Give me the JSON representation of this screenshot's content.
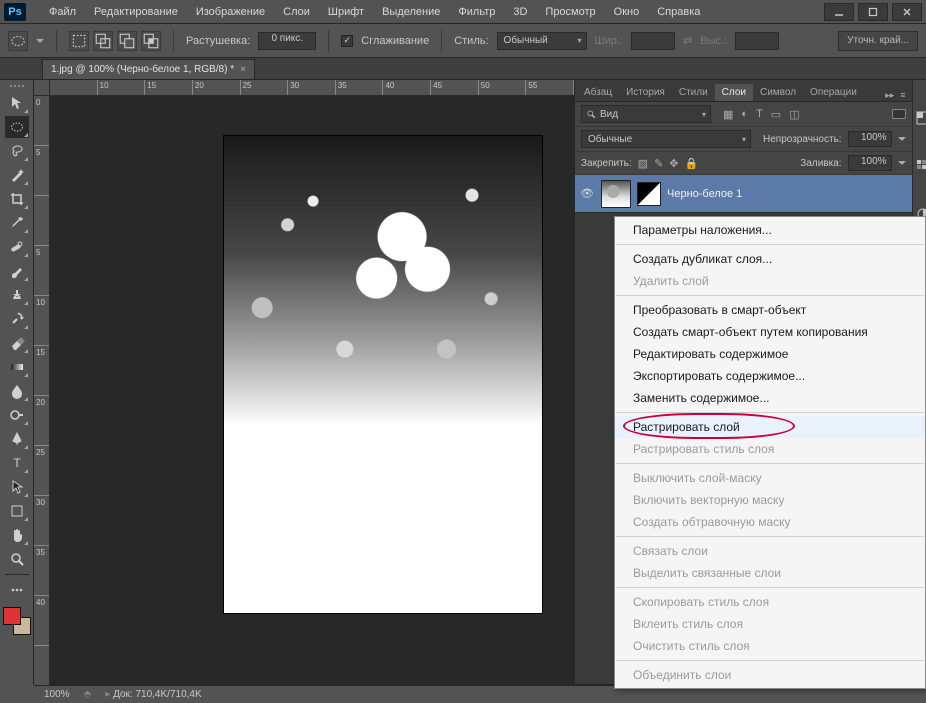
{
  "app": {
    "logo": "Ps"
  },
  "menus": [
    "Файл",
    "Редактирование",
    "Изображение",
    "Слои",
    "Шрифт",
    "Выделение",
    "Фильтр",
    "3D",
    "Просмотр",
    "Окно",
    "Справка"
  ],
  "options": {
    "feather_label": "Растушевка:",
    "feather_value": "0 пикс.",
    "antialias_label": "Сглаживание",
    "style_label": "Стиль:",
    "style_value": "Обычный",
    "width_label": "Шир.:",
    "height_label": "Выс.:",
    "refine_edge": "Уточн. край..."
  },
  "document_tab": {
    "title": "1.jpg @ 100% (Черно-белое 1, RGB/8) *"
  },
  "ruler_h": [
    "",
    "10",
    "15",
    "20",
    "25",
    "30",
    "35",
    "40",
    "45",
    "50",
    "55"
  ],
  "ruler_v": [
    "0",
    "5",
    "",
    "5",
    "10",
    "15",
    "20",
    "25",
    "30",
    "35",
    "40"
  ],
  "panels": {
    "tabs": [
      "Абзац",
      "История",
      "Стили",
      "Слои",
      "Символ",
      "Операции"
    ],
    "tab_icons": "▸▸",
    "menu_icon": "≡"
  },
  "layers": {
    "filter_type": "Вид",
    "blend_mode": "Обычные",
    "opacity_label": "Непрозрачность:",
    "opacity_value": "100%",
    "lock_label": "Закрепить:",
    "fill_label": "Заливка:",
    "fill_value": "100%",
    "items": [
      {
        "name": "Черно-белое 1"
      }
    ]
  },
  "context_menu": {
    "items": [
      {
        "label": "Параметры наложения...",
        "enabled": true
      },
      {
        "sep": true
      },
      {
        "label": "Создать дубликат слоя...",
        "enabled": true
      },
      {
        "label": "Удалить слой",
        "enabled": false
      },
      {
        "sep": true
      },
      {
        "label": "Преобразовать в смарт-объект",
        "enabled": true
      },
      {
        "label": "Создать смарт-объект путем копирования",
        "enabled": true
      },
      {
        "label": "Редактировать содержимое",
        "enabled": true
      },
      {
        "label": "Экспортировать содержимое...",
        "enabled": true
      },
      {
        "label": "Заменить содержимое...",
        "enabled": true
      },
      {
        "sep": true
      },
      {
        "label": "Растрировать слой",
        "enabled": true,
        "highlight": true,
        "circled": true
      },
      {
        "label": "Растрировать стиль слоя",
        "enabled": false
      },
      {
        "sep": true
      },
      {
        "label": "Выключить слой-маску",
        "enabled": false
      },
      {
        "label": "Включить векторную маску",
        "enabled": false
      },
      {
        "label": "Создать обтравочную маску",
        "enabled": false
      },
      {
        "sep": true
      },
      {
        "label": "Связать слои",
        "enabled": false
      },
      {
        "label": "Выделить связанные слои",
        "enabled": false
      },
      {
        "sep": true
      },
      {
        "label": "Скопировать стиль слоя",
        "enabled": false
      },
      {
        "label": "Вклеить стиль слоя",
        "enabled": false
      },
      {
        "label": "Очистить стиль слоя",
        "enabled": false
      },
      {
        "sep": true
      },
      {
        "label": "Объединить слои",
        "enabled": false
      }
    ]
  },
  "status": {
    "zoom": "100%",
    "doc": "Док: 710,4K/710,4K"
  },
  "colors": {
    "accent": "#5b7aa8",
    "highlight_ring": "#c9003a",
    "fg_swatch": "#d33",
    "bg_swatch": "#c9b99c"
  }
}
